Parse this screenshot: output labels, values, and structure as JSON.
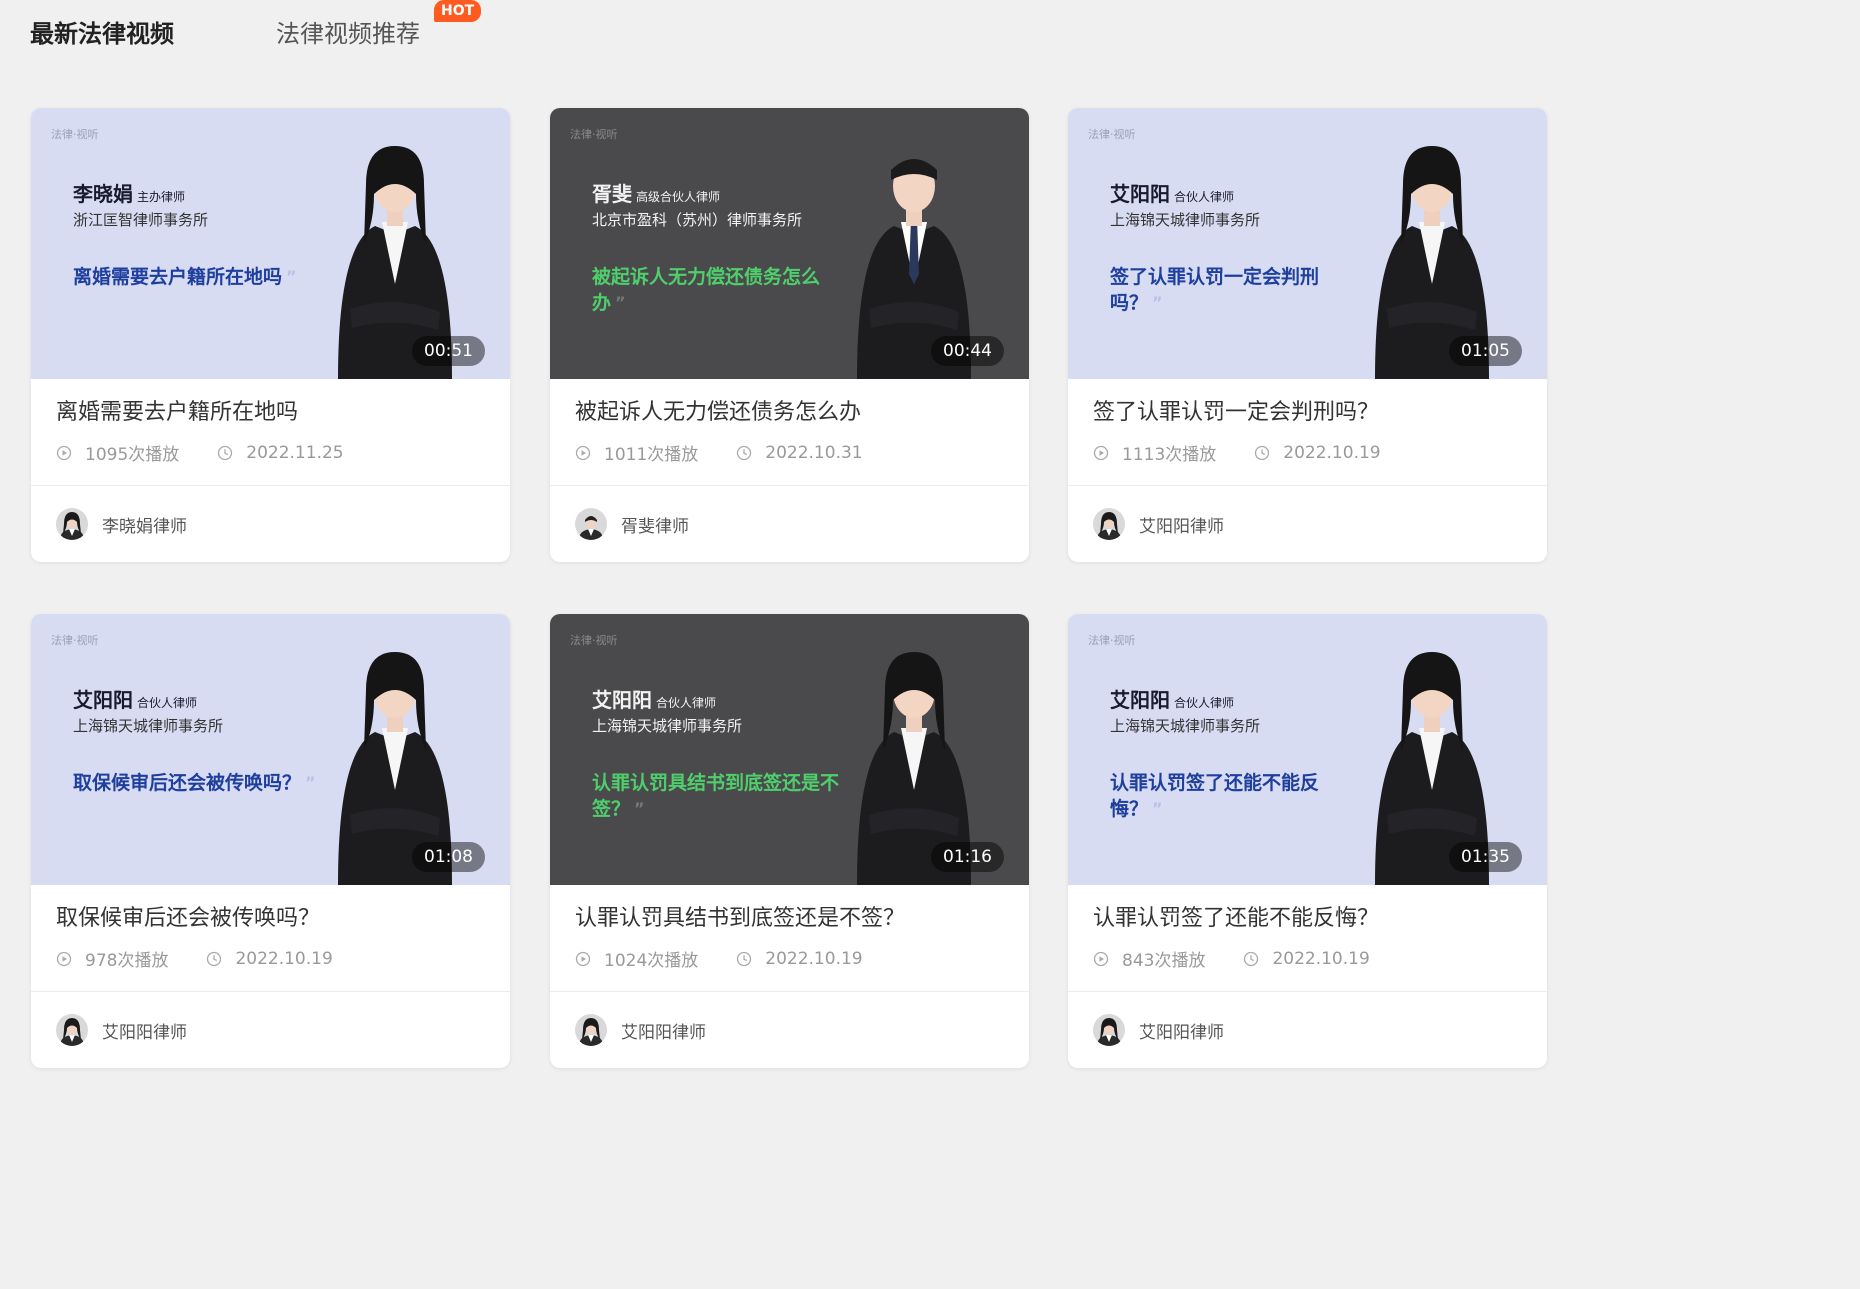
{
  "tabs": {
    "active": "最新法律视频",
    "other": "法律视频推荐",
    "hot_badge": "HOT"
  },
  "colors": {
    "thumb_light": "#d8dcf3",
    "thumb_dark": "#4a4a4c",
    "question_light": "#1e3f9e",
    "question_dark": "#4fcf6b",
    "hot": "#ff5a1f"
  },
  "icons": {
    "play": "play-circle-icon",
    "clock": "clock-icon"
  },
  "cards": [
    {
      "theme": "light",
      "watermark": "法律·视听",
      "lawyer": "李晓娟",
      "role": "主办律师",
      "firm": "浙江匡智律师事务所",
      "question": "离婚需要去户籍所在地吗",
      "duration": "00:51",
      "title": "离婚需要去户籍所在地吗",
      "plays": "1095次播放",
      "date": "2022.11.25",
      "author": "李晓娟律师"
    },
    {
      "theme": "dark",
      "watermark": "法律·视听",
      "lawyer": "胥斐",
      "role": "高级合伙人律师",
      "firm": "北京市盈科（苏州）律师事务所",
      "question": "被起诉人无力偿还债务怎么办",
      "duration": "00:44",
      "title": "被起诉人无力偿还债务怎么办",
      "plays": "1011次播放",
      "date": "2022.10.31",
      "author": "胥斐律师"
    },
    {
      "theme": "light",
      "watermark": "法律·视听",
      "lawyer": "艾阳阳",
      "role": "合伙人律师",
      "firm": "上海锦天城律师事务所",
      "question": "签了认罪认罚一定会判刑吗？",
      "duration": "01:05",
      "title": "签了认罪认罚一定会判刑吗？",
      "plays": "1113次播放",
      "date": "2022.10.19",
      "author": "艾阳阳律师"
    },
    {
      "theme": "light",
      "watermark": "法律·视听",
      "lawyer": "艾阳阳",
      "role": "合伙人律师",
      "firm": "上海锦天城律师事务所",
      "question": "取保候审后还会被传唤吗？",
      "duration": "01:08",
      "title": "取保候审后还会被传唤吗？",
      "plays": "978次播放",
      "date": "2022.10.19",
      "author": "艾阳阳律师"
    },
    {
      "theme": "dark",
      "watermark": "法律·视听",
      "lawyer": "艾阳阳",
      "role": "合伙人律师",
      "firm": "上海锦天城律师事务所",
      "question": "认罪认罚具结书到底签还是不签？",
      "duration": "01:16",
      "title": "认罪认罚具结书到底签还是不签？",
      "plays": "1024次播放",
      "date": "2022.10.19",
      "author": "艾阳阳律师"
    },
    {
      "theme": "light",
      "watermark": "法律·视听",
      "lawyer": "艾阳阳",
      "role": "合伙人律师",
      "firm": "上海锦天城律师事务所",
      "question": "认罪认罚签了还能不能反悔？",
      "duration": "01:35",
      "title": "认罪认罚签了还能不能反悔？",
      "plays": "843次播放",
      "date": "2022.10.19",
      "author": "艾阳阳律师"
    }
  ]
}
